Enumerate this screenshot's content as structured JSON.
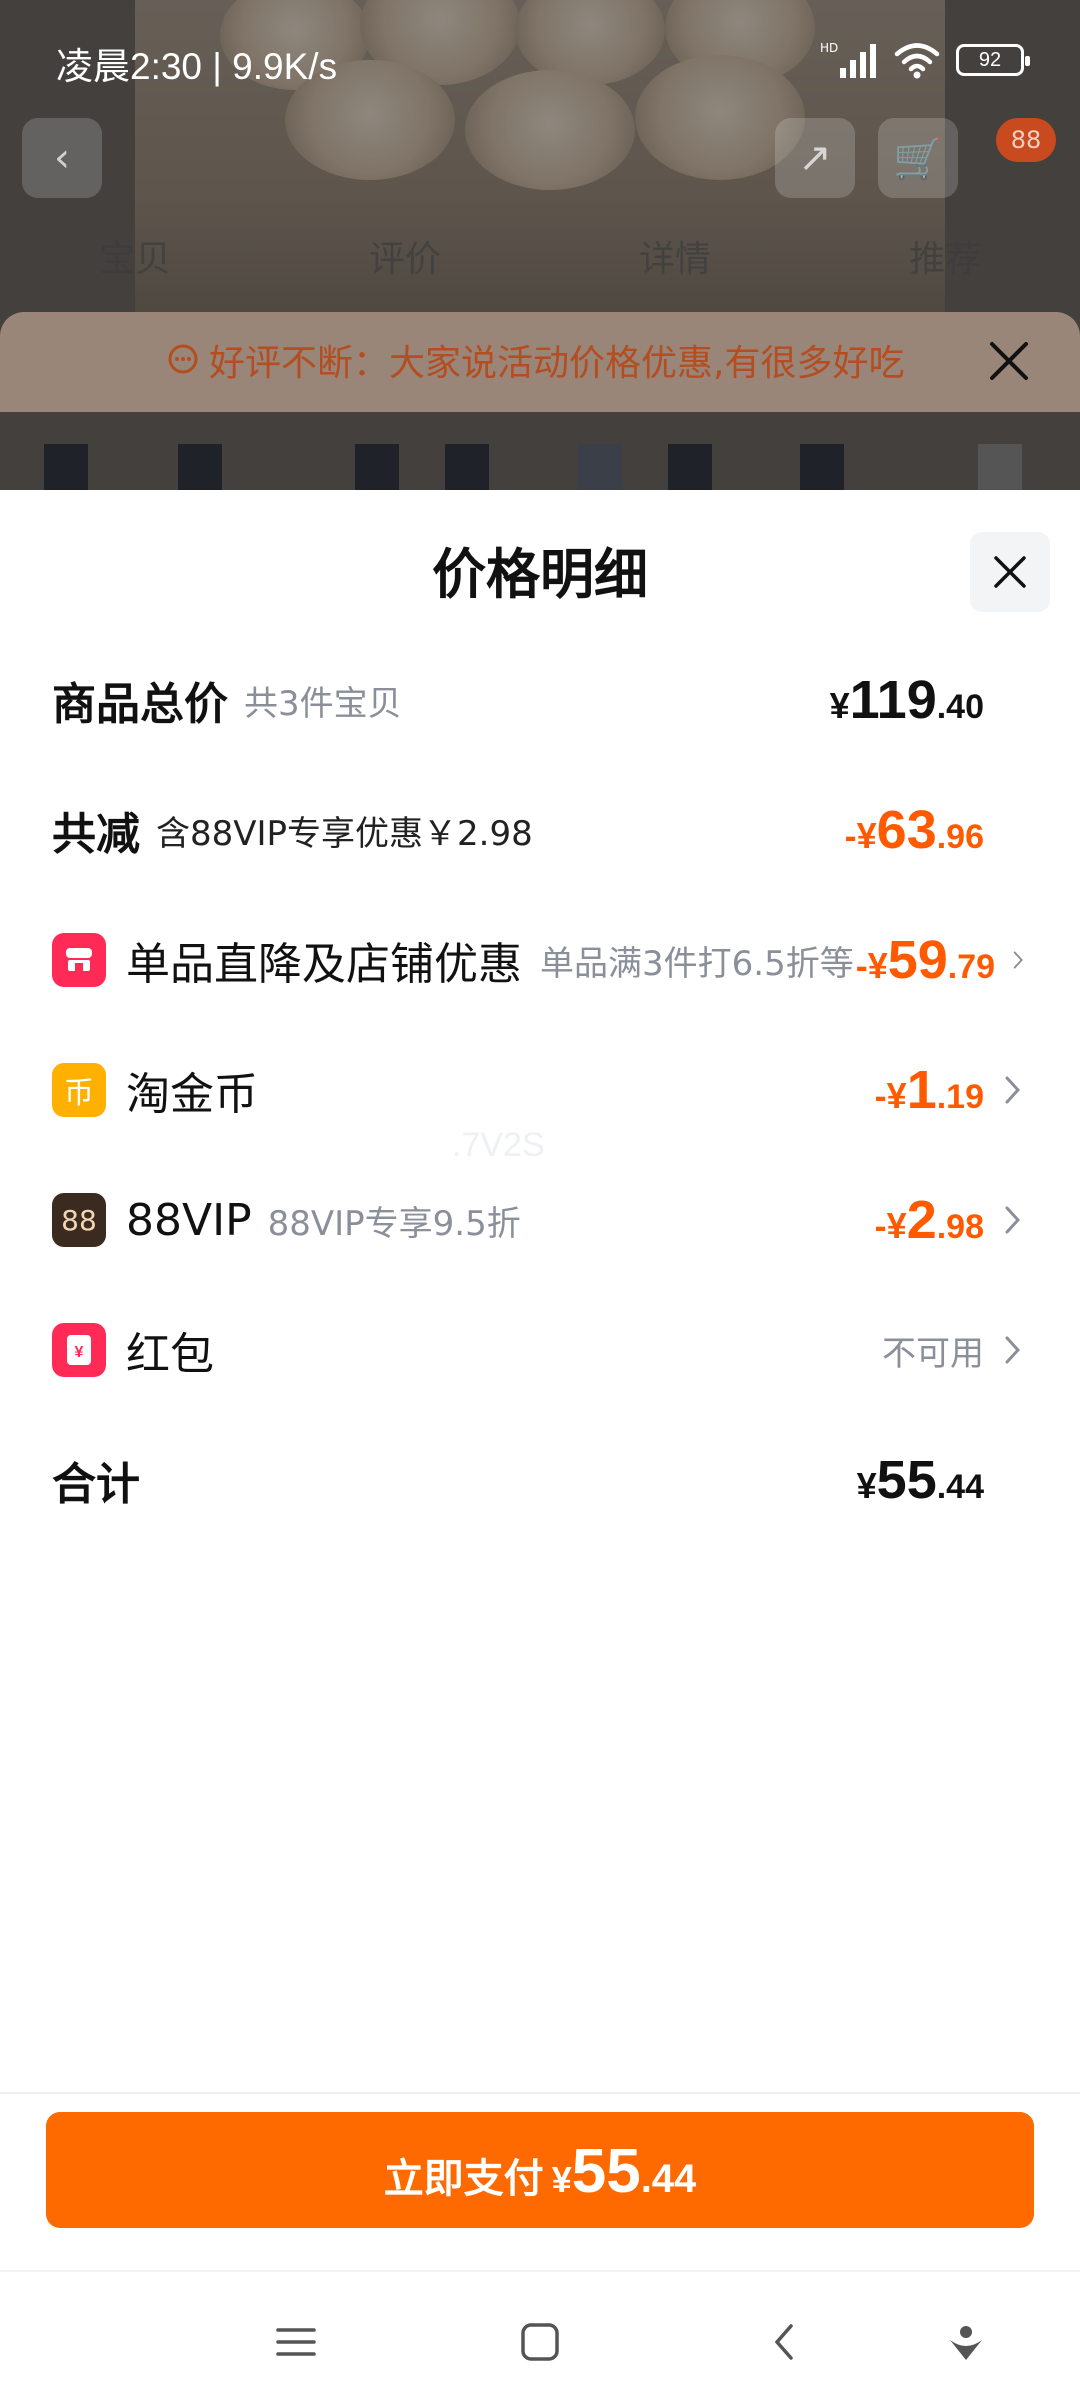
{
  "status_bar": {
    "time_speed": "凌晨2:30 | 9.9K/s",
    "hd_label": "HD",
    "battery": "92"
  },
  "background": {
    "badge": "88",
    "tabs": [
      "宝贝",
      "评价",
      "详情",
      "推荐"
    ],
    "notice": "好评不断：大家说活动价格优惠,有很多好吃"
  },
  "sheet": {
    "title": "价格明细",
    "rows": [
      {
        "label": "商品总价",
        "sub": "共3件宝贝",
        "amount": {
          "sym": "¥",
          "int": "119",
          "dec": ".40"
        }
      },
      {
        "label": "共减",
        "sub": "含88VIP专享优惠￥2.98",
        "amount": {
          "sym": "-¥",
          "int": "63",
          "dec": ".96"
        }
      },
      {
        "icon": "shop-icon",
        "icon_color": "#ff2a55",
        "label": "单品直降及店铺优惠",
        "sub": "单品满3件打6.5折等",
        "amount": {
          "sym": "-¥",
          "int": "59",
          "dec": ".79"
        }
      },
      {
        "icon": "coin-icon",
        "icon_color": "#ffb000",
        "icon_text": "币",
        "label": "淘金币",
        "amount": {
          "sym": "-¥",
          "int": "1",
          "dec": ".19"
        }
      },
      {
        "icon": "vip-88-icon",
        "icon_color": "#3a2a20",
        "icon_text": "88",
        "label": "88VIP",
        "sub": "88VIP专享9.5折",
        "amount": {
          "sym": "-¥",
          "int": "2",
          "dec": ".98"
        }
      },
      {
        "icon": "red-packet-icon",
        "icon_color": "#ff2a55",
        "label": "红包",
        "status": "不可用"
      },
      {
        "label": "合计",
        "amount": {
          "sym": "¥",
          "int": "55",
          "dec": ".44"
        }
      }
    ],
    "watermark": ".7V2S"
  },
  "pay_button": {
    "label": "立即支付",
    "sym": "¥",
    "int": "55",
    "dec": ".44"
  },
  "colors": {
    "accent": "#ff6a00",
    "discount": "#ff5a00",
    "muted": "#8a8f99"
  }
}
